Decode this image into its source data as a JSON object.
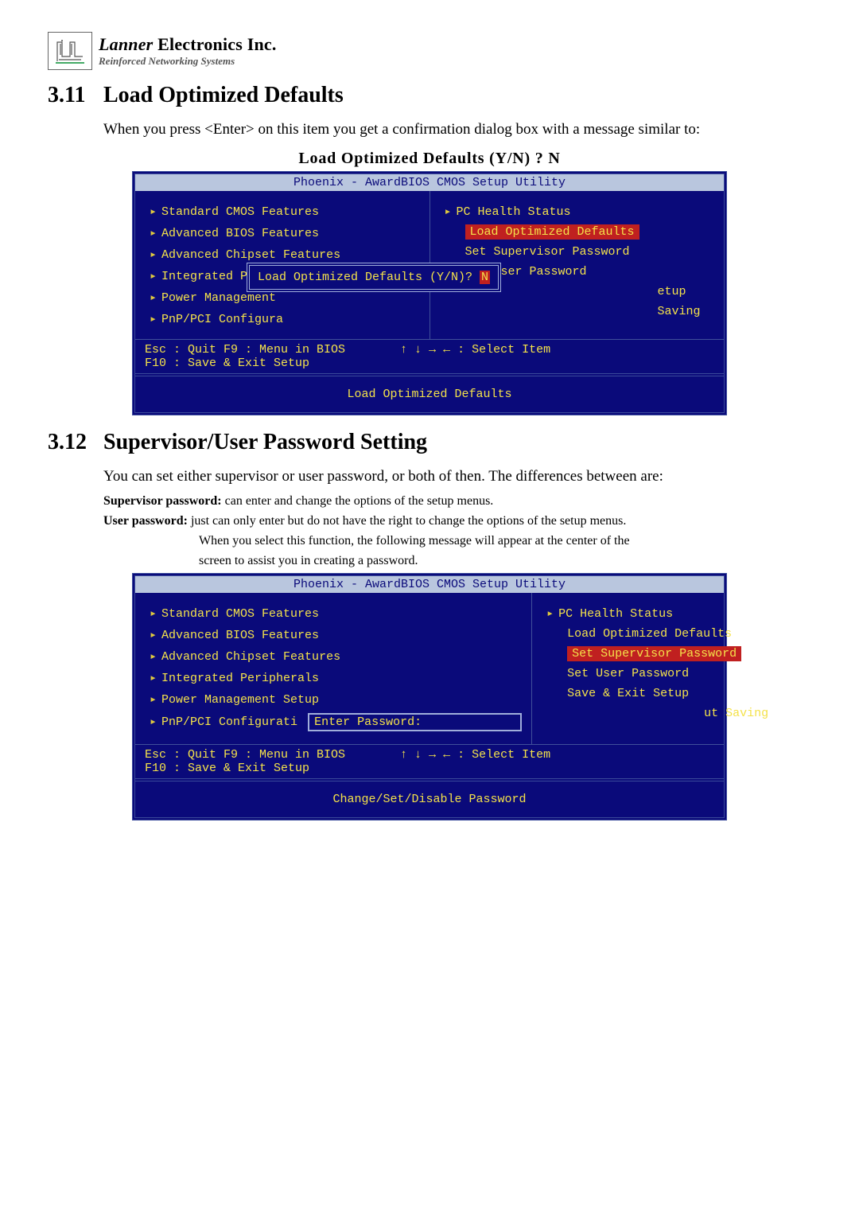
{
  "logo": {
    "brand_italic": "Lanner",
    "brand_rest": " Electronics Inc.",
    "tagline": "Reinforced Networking Systems"
  },
  "sec311": {
    "num": "3.11",
    "title": "Load Optimized Defaults",
    "para": "When you press <Enter> on this item you get a confirmation dialog box with a message similar to:",
    "dialog_title": "Load Optimized Defaults (Y/N) ? N"
  },
  "sec312": {
    "num": "3.12",
    "title": "Supervisor/User Password Setting",
    "para1": "You can set either supervisor or user password, or both of then. The differences between are:",
    "sup_bold": "Supervisor password:",
    "sup_rest": " can enter and change the options of the setup menus.",
    "usr_bold": "User password:",
    "usr_rest": " just can only enter but do not have the right to change the options of the setup menus.",
    "extra1": "When you select this function, the following message will appear at the center of the",
    "extra2": "screen to assist you in creating a password."
  },
  "bios_common": {
    "title": "Phoenix - AwardBIOS CMOS Setup Utility",
    "left": {
      "std": "Standard CMOS Features",
      "adv_bios": "Advanced BIOS Features",
      "adv_chip": "Advanced Chipset Features",
      "periph": "Integrated Peripherals",
      "power": "Power Management",
      "power_full": "Power Management Setup",
      "pnp_short": "PnP/PCI Configura",
      "pnp": "PnP/PCI Configurati"
    },
    "right": {
      "pc": "PC Health Status",
      "load": "Load Optimized Defaults",
      "sup": "Set Supervisor Password",
      "usr": "Set User Password",
      "save": "Save & Exit Setup",
      "etup": "etup",
      "saving": "Saving",
      "ut_saving": "ut Saving"
    },
    "footer_left": "Esc : Quit     F9 : Menu in BIOS",
    "footer_left2": "F10 : Save & Exit Setup",
    "footer_right": "↑ ↓ → ←   : Select Item",
    "hint_load": "Load Optimized Defaults",
    "hint_pass": "Change/Set/Disable Password",
    "modal1": "Load Optimized Defaults (Y/N)? ",
    "modal1_n": "N",
    "modal2_label": "Enter Password:"
  }
}
